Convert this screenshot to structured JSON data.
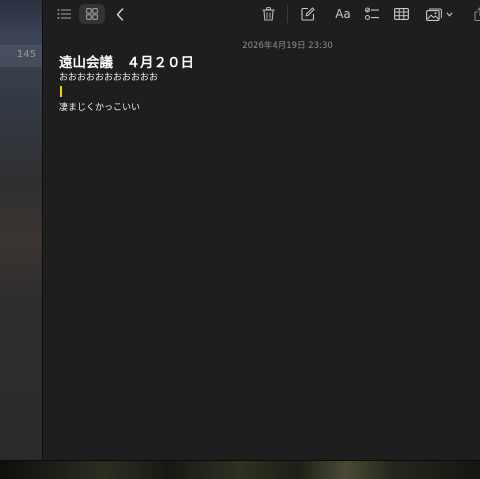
{
  "sidebar": {
    "count": "145"
  },
  "toolbar": {
    "icons": {
      "list_view": "list-view-icon",
      "gallery_view": "gallery-view-icon",
      "back": "chevron-left-icon",
      "delete": "trash-icon",
      "compose": "compose-icon",
      "format": "text-format-icon",
      "checklist": "checklist-icon",
      "table": "table-icon",
      "media": "media-icon",
      "media_dropdown": "chevron-down-icon",
      "share": "share-icon"
    },
    "format_label": "Aa"
  },
  "note": {
    "timestamp": "2026年4月19日 23:30",
    "title": "遠山会議　４月２０日",
    "line1": "おおおおおおおおおおお",
    "line3": "凄まじくかっこいい"
  },
  "colors": {
    "background": "#1e1e1e",
    "caret": "#f5d000",
    "timestamp": "#8e8e93",
    "icon": "#c7c7cc"
  }
}
